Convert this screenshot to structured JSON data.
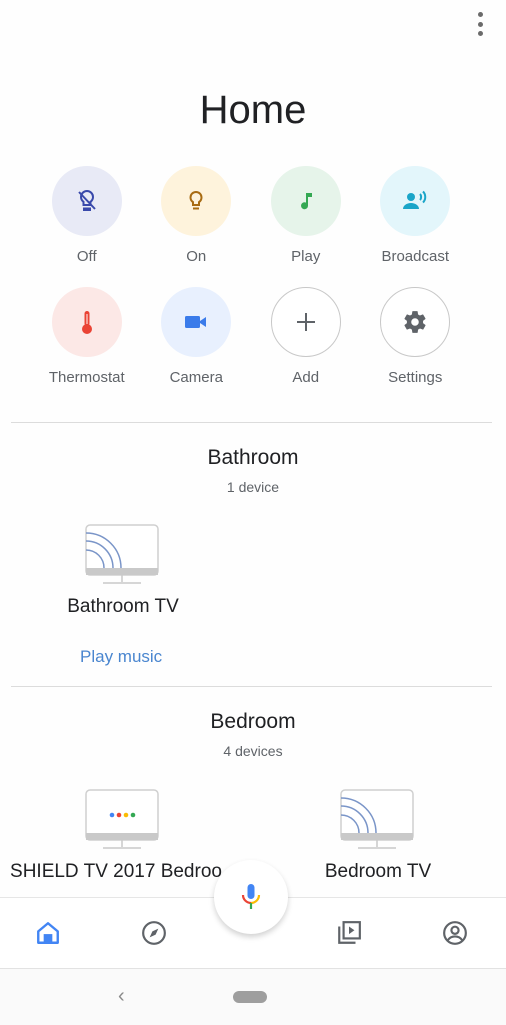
{
  "header": {
    "title": "Home",
    "more_icon": "more-vert-icon"
  },
  "actions": [
    {
      "label": "Off",
      "icon": "lightbulb-off-icon",
      "bg": "#e8eaf6",
      "fg": "#3949ab"
    },
    {
      "label": "On",
      "icon": "lightbulb-icon",
      "bg": "#fef3dc",
      "fg": "#a86b12"
    },
    {
      "label": "Play",
      "icon": "music-note-icon",
      "bg": "#e6f4ea",
      "fg": "#34a853"
    },
    {
      "label": "Broadcast",
      "icon": "broadcast-icon",
      "bg": "#e3f6fb",
      "fg": "#1aa5c8"
    },
    {
      "label": "Thermostat",
      "icon": "thermometer-icon",
      "bg": "#fce8e6",
      "fg": "#ea4335"
    },
    {
      "label": "Camera",
      "icon": "videocam-icon",
      "bg": "#e8f0fe",
      "fg": "#3a7bea"
    },
    {
      "label": "Add",
      "icon": "plus-icon",
      "bg": "#ffffff",
      "fg": "#5f6368"
    },
    {
      "label": "Settings",
      "icon": "gear-icon",
      "bg": "#ffffff",
      "fg": "#5f6368"
    }
  ],
  "rooms": [
    {
      "name": "Bathroom",
      "count": "1 device",
      "devices": [
        {
          "name": "Bathroom TV",
          "icon": "cast-tv-icon",
          "action": "Play music"
        }
      ]
    },
    {
      "name": "Bedroom",
      "count": "4 devices",
      "devices": [
        {
          "name": "SHIELD TV 2017 Bedroo",
          "icon": "google-tv-icon"
        },
        {
          "name": "Bedroom TV",
          "icon": "cast-tv-icon"
        }
      ]
    }
  ],
  "bottom_nav": {
    "items": [
      {
        "icon": "home-icon",
        "active": true
      },
      {
        "icon": "explore-compass-icon",
        "active": false
      },
      {
        "icon": "mic-icon",
        "active": false
      },
      {
        "icon": "media-library-icon",
        "active": false
      },
      {
        "icon": "account-icon",
        "active": false
      }
    ],
    "accent": "#4285f4"
  },
  "system_nav": {
    "back_glyph": "‹"
  }
}
